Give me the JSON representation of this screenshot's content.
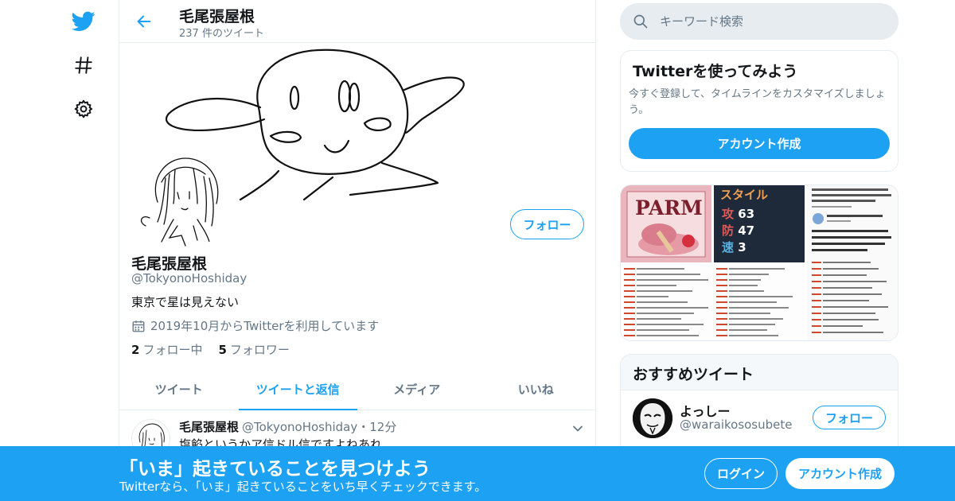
{
  "colors": {
    "accent": "#1da1f2",
    "text": "#14171a",
    "muted": "#657786",
    "border": "#e6ecf0"
  },
  "leftnav": {
    "items": [
      {
        "icon": "twitter-bird-icon"
      },
      {
        "icon": "hashtag-icon"
      },
      {
        "icon": "gear-icon"
      }
    ]
  },
  "header": {
    "title": "毛尾張屋根",
    "tweet_count": "237 件のツイート"
  },
  "profile": {
    "follow_label": "フォロー",
    "name": "毛尾張屋根",
    "handle": "@TokyonoHoshiday",
    "bio": "東京で星は見えない",
    "joined": "2019年10月からTwitterを利用しています",
    "following_count": "2",
    "following_label": "フォロー中",
    "followers_count": "5",
    "followers_label": "フォロワー"
  },
  "tabs": [
    {
      "label": "ツイート",
      "active": false
    },
    {
      "label": "ツイートと返信",
      "active": true
    },
    {
      "label": "メディア",
      "active": false
    },
    {
      "label": "いいね",
      "active": false
    }
  ],
  "tweet": {
    "name": "毛尾張屋根",
    "handle_time": "@TokyonoHoshiday・12分",
    "text": "塩餡というかア信ドル信ですよねあれ"
  },
  "search": {
    "placeholder": "キーワード検索",
    "value": ""
  },
  "try_card": {
    "title": "Twitterを使ってみよう",
    "text": "今すぐ登録して、タイムラインをカスタマイズしましょう。",
    "button": "アカウント作成"
  },
  "media": {
    "tile1_text": "PARM",
    "tile2_text": "スタイル",
    "tile2_stats": [
      "攻",
      "63",
      "防",
      "47",
      "速",
      "3"
    ]
  },
  "recommended": {
    "title": "おすすめツイート",
    "name": "よっしー",
    "handle": "@waraikososubete",
    "follow_label": "フォロー"
  },
  "bottombar": {
    "title": "「いま」起きていることを見つけよう",
    "subtitle": "Twitterなら、「いま」起きていることをいち早くチェックできます。",
    "login": "ログイン",
    "signup": "アカウント作成"
  }
}
